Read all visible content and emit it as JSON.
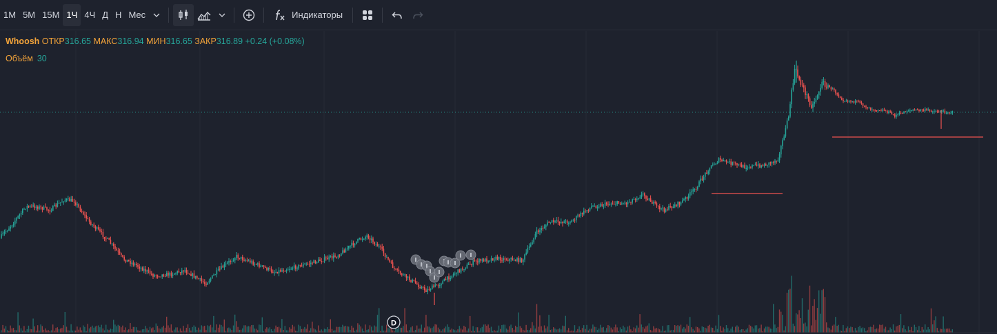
{
  "toolbar": {
    "intervals": [
      "1М",
      "5М",
      "15М",
      "1Ч",
      "4Ч",
      "Д",
      "Н",
      "Мес"
    ],
    "active_interval": "1Ч",
    "indicators_label": "Индикаторы",
    "icons": [
      "chevron-down-icon",
      "candles-icon",
      "area-chart-icon",
      "chevron-down-icon",
      "add-circle-icon",
      "function-icon",
      "layouts-grid-icon",
      "undo-icon",
      "redo-icon"
    ]
  },
  "legend": {
    "symbol": "Whoosh",
    "open_label": "ОТКР",
    "open": "316.65",
    "high_label": "МАКС",
    "high": "316.94",
    "low_label": "МИН",
    "low": "316.65",
    "close_label": "ЗАКР",
    "close": "316.89",
    "change": "+0.24 (+0.08%)"
  },
  "volume_legend": {
    "label": "Объём",
    "value": "30"
  },
  "dividend_marker": "D",
  "colors": {
    "up": "#26a69a",
    "down": "#ef5350",
    "accent": "#f2a33a",
    "background": "#1e222d",
    "grid": "#2a2e39"
  },
  "chart_data": {
    "type": "candlestick",
    "interval": "1Ч",
    "price_line": 316.89,
    "horizontal_lines": 2,
    "trend_path": [
      [
        0,
        348
      ],
      [
        20,
        325
      ],
      [
        40,
        300
      ],
      [
        55,
        300
      ],
      [
        75,
        305
      ],
      [
        95,
        290
      ],
      [
        110,
        292
      ],
      [
        130,
        320
      ],
      [
        160,
        350
      ],
      [
        180,
        375
      ],
      [
        200,
        385
      ],
      [
        225,
        400
      ],
      [
        250,
        398
      ],
      [
        270,
        392
      ],
      [
        300,
        412
      ],
      [
        320,
        392
      ],
      [
        345,
        372
      ],
      [
        370,
        382
      ],
      [
        400,
        395
      ],
      [
        430,
        388
      ],
      [
        460,
        380
      ],
      [
        490,
        372
      ],
      [
        520,
        350
      ],
      [
        535,
        342
      ],
      [
        555,
        362
      ],
      [
        575,
        392
      ],
      [
        600,
        408
      ],
      [
        620,
        422
      ],
      [
        640,
        412
      ],
      [
        660,
        398
      ],
      [
        690,
        380
      ],
      [
        720,
        375
      ],
      [
        760,
        378
      ],
      [
        780,
        338
      ],
      [
        800,
        322
      ],
      [
        830,
        322
      ],
      [
        860,
        300
      ],
      [
        890,
        295
      ],
      [
        910,
        295
      ],
      [
        935,
        282
      ],
      [
        955,
        300
      ],
      [
        965,
        305
      ],
      [
        990,
        294
      ],
      [
        1010,
        275
      ],
      [
        1030,
        245
      ],
      [
        1045,
        232
      ],
      [
        1080,
        242
      ],
      [
        1110,
        240
      ],
      [
        1130,
        232
      ],
      [
        1145,
        175
      ],
      [
        1155,
        100
      ],
      [
        1168,
        130
      ],
      [
        1180,
        155
      ],
      [
        1195,
        120
      ],
      [
        1210,
        130
      ],
      [
        1225,
        145
      ],
      [
        1245,
        148
      ],
      [
        1265,
        158
      ],
      [
        1285,
        160
      ],
      [
        1300,
        168
      ],
      [
        1320,
        160
      ],
      [
        1345,
        160
      ],
      [
        1365,
        162
      ],
      [
        1383,
        163
      ]
    ]
  }
}
